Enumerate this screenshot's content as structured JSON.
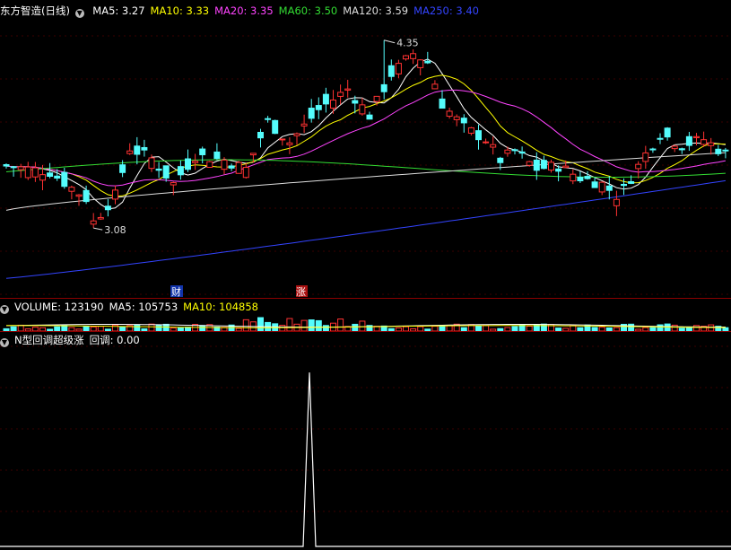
{
  "main_header": {
    "stock_name": "东方智造",
    "period": "(日线)",
    "ma": [
      {
        "label": "MA5: 3.27",
        "color": "#ffffff"
      },
      {
        "label": "MA10: 3.33",
        "color": "#ffff00"
      },
      {
        "label": "MA20: 3.35",
        "color": "#ff44ff"
      },
      {
        "label": "MA60: 3.50",
        "color": "#33dd33"
      },
      {
        "label": "MA120: 3.59",
        "color": "#dddddd"
      },
      {
        "label": "MA250: 3.40",
        "color": "#3344ff"
      }
    ]
  },
  "volume_header": {
    "title": "VOLUME: 123190",
    "ma5": "MA5: 105753",
    "ma10": "MA10: 104858"
  },
  "indicator_header": {
    "title": "N型回调超级涨",
    "value": "回调: 0.00"
  },
  "markers": {
    "cai": "财",
    "zhang": "涨"
  },
  "chart_data": [
    {
      "type": "candlestick",
      "title": "东方智造 (日线)",
      "high_annotation": "4.35",
      "low_annotation": "3.08",
      "high_value": 4.35,
      "low_value": 3.08,
      "ylim": [
        2.62,
        4.5
      ],
      "colors": {
        "up": "#ff3232",
        "down": "#54fcfc",
        "ma5": "#ffffff",
        "ma10": "#ffff00",
        "ma20": "#ff44ff",
        "ma60": "#33dd33",
        "ma120": "#dddddd",
        "ma250": "#3344ff"
      },
      "ma_end": {
        "ma5": 3.27,
        "ma10": 3.33,
        "ma20": 3.35,
        "ma60": 3.5,
        "ma120": 3.59,
        "ma250": 3.4
      }
    },
    {
      "type": "bar",
      "title": "VOLUME",
      "last": 123190,
      "ma5": 105753,
      "ma10": 104858
    },
    {
      "type": "line",
      "title": "N型回调超级涨",
      "series_label": "回调",
      "last": 0.0,
      "spike_index": 64,
      "spike_value": 1.0,
      "ylim": [
        0,
        1.15
      ]
    }
  ]
}
